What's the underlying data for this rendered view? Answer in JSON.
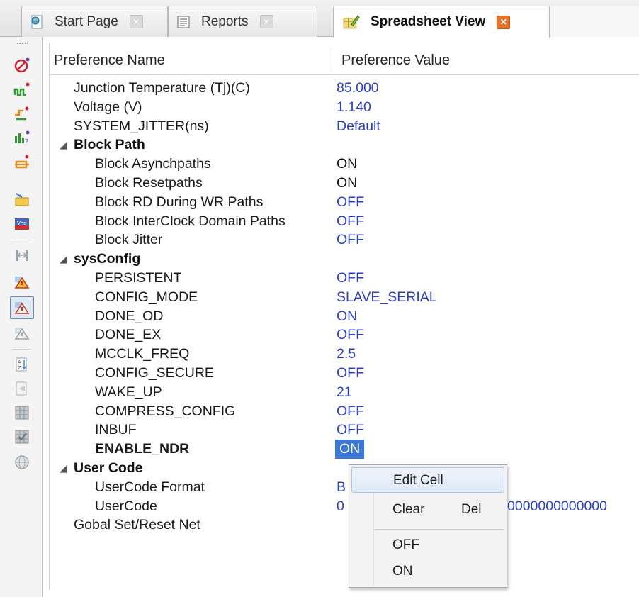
{
  "tabs": [
    {
      "label": "Start Page",
      "icon": "start-page-icon",
      "active": false
    },
    {
      "label": "Reports",
      "icon": "reports-icon",
      "active": false
    },
    {
      "label": "Spreadsheet View",
      "icon": "spreadsheet-icon",
      "active": true
    }
  ],
  "toolbar_icons": [
    "no-timing-icon",
    "clock-icon",
    "port-assign-icon",
    "pin-assign-icon",
    "signal-icon",
    "folder-arrow-icon",
    "image-icon",
    "resize-icon",
    "warning-icon",
    "warning-filter-icon",
    "warning-disabled-icon",
    "sort-icon",
    "refresh-icon",
    "grid-icon",
    "grid-check-icon",
    "globe-icon"
  ],
  "columns": {
    "name": "Preference Name",
    "value": "Preference Value"
  },
  "rows": [
    {
      "name": "Junction Temperature (Tj)(C)",
      "value": "85.000",
      "level": 1
    },
    {
      "name": "Voltage (V)",
      "value": "1.140",
      "level": 1
    },
    {
      "name": "SYSTEM_JITTER(ns)",
      "value": "Default",
      "level": 1
    },
    {
      "name": "Block Path",
      "value": "",
      "level": 0,
      "group": true
    },
    {
      "name": "Block Asynchpaths",
      "value": "ON",
      "level": 2,
      "black": true
    },
    {
      "name": "Block Resetpaths",
      "value": "ON",
      "level": 2,
      "black": true
    },
    {
      "name": "Block RD During WR Paths",
      "value": "OFF",
      "level": 2
    },
    {
      "name": "Block InterClock Domain Paths",
      "value": "OFF",
      "level": 2
    },
    {
      "name": "Block Jitter",
      "value": "OFF",
      "level": 2
    },
    {
      "name": "sysConfig",
      "value": "",
      "level": 0,
      "group": true
    },
    {
      "name": "PERSISTENT",
      "value": "OFF",
      "level": 2
    },
    {
      "name": "CONFIG_MODE",
      "value": "SLAVE_SERIAL",
      "level": 2
    },
    {
      "name": "DONE_OD",
      "value": "ON",
      "level": 2
    },
    {
      "name": "DONE_EX",
      "value": "OFF",
      "level": 2
    },
    {
      "name": "MCCLK_FREQ",
      "value": "2.5",
      "level": 2
    },
    {
      "name": "CONFIG_SECURE",
      "value": "OFF",
      "level": 2
    },
    {
      "name": "WAKE_UP",
      "value": "21",
      "level": 2
    },
    {
      "name": "COMPRESS_CONFIG",
      "value": "OFF",
      "level": 2
    },
    {
      "name": "INBUF",
      "value": "OFF",
      "level": 2
    },
    {
      "name": "ENABLE_NDR",
      "value": "ON",
      "level": 2,
      "bold": true,
      "selected": true
    },
    {
      "name": "User Code",
      "value": "",
      "level": 0,
      "group": true
    },
    {
      "name": "UserCode Format",
      "value": "B",
      "level": 2
    },
    {
      "name": "UserCode",
      "value": "0",
      "level": 2,
      "tail": "0000000000000"
    },
    {
      "name": "Gobal Set/Reset Net",
      "value": "",
      "level": 1
    }
  ],
  "context_menu": {
    "items": [
      {
        "label": "Edit Cell",
        "shortcut": "",
        "hover": true
      },
      {
        "label": "Clear",
        "shortcut": "Del",
        "hover": false
      },
      {
        "label": "OFF",
        "shortcut": "",
        "hover": false
      },
      {
        "label": "ON",
        "shortcut": "",
        "hover": false
      }
    ]
  },
  "colors": {
    "value_blue": "#2b3fc8",
    "selection": "#3a78d8",
    "active_close": "#e7742b"
  }
}
